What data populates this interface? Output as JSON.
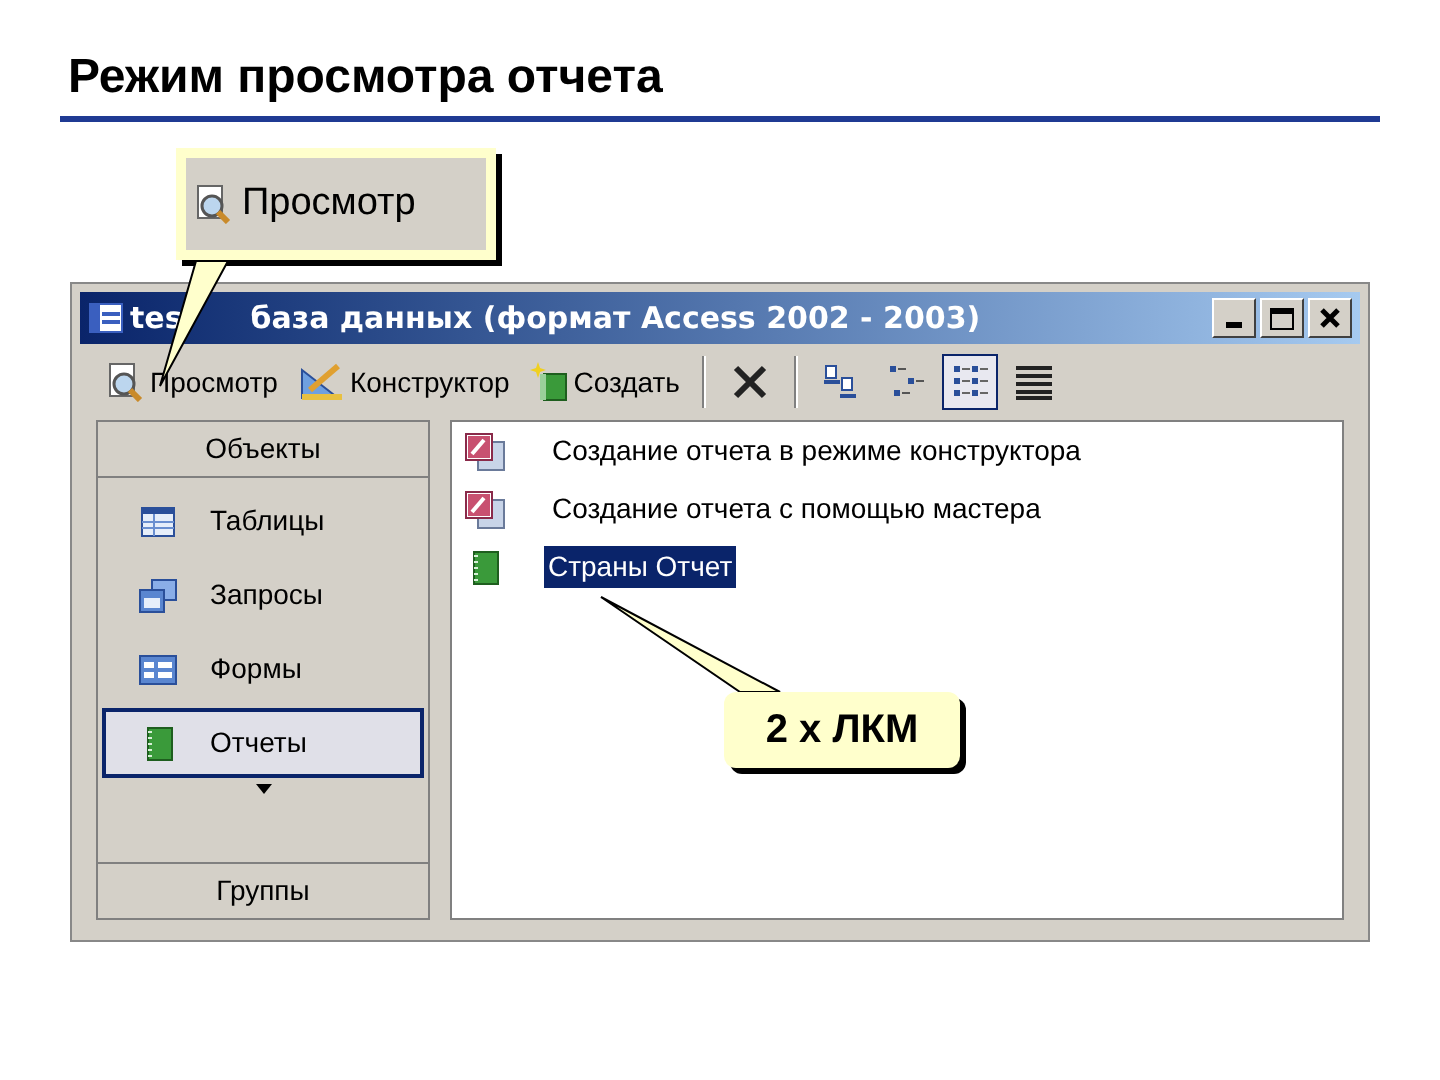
{
  "slide_title": "Режим просмотра отчета",
  "callout_top": {
    "label": "Просмотр"
  },
  "window": {
    "title_left": "tes",
    "title_right": "база данных (формат Access 2002 - 2003)"
  },
  "toolbar": [
    {
      "kind": "preview",
      "label": "Просмотр",
      "selected": false
    },
    {
      "kind": "design",
      "label": "Конструктор",
      "selected": false
    },
    {
      "kind": "new",
      "label": "Создать",
      "selected": false
    },
    {
      "kind": "sep"
    },
    {
      "kind": "delete",
      "selected": false
    },
    {
      "kind": "sep"
    },
    {
      "kind": "large",
      "selected": false
    },
    {
      "kind": "small",
      "selected": false
    },
    {
      "kind": "list",
      "selected": true
    },
    {
      "kind": "details",
      "selected": false
    }
  ],
  "sidebar": {
    "header": "Объекты",
    "items": [
      {
        "label": "Таблицы",
        "kind": "table",
        "selected": false
      },
      {
        "label": "Запросы",
        "kind": "query",
        "selected": false
      },
      {
        "label": "Формы",
        "kind": "form",
        "selected": false
      },
      {
        "label": "Отчеты",
        "kind": "report",
        "selected": true
      }
    ],
    "footer": "Группы"
  },
  "objects": [
    {
      "label": "Создание отчета в режиме конструктора",
      "kind": "wizard",
      "selected": false
    },
    {
      "label": "Создание отчета с помощью мастера",
      "kind": "wizard",
      "selected": false
    },
    {
      "label": "Страны Отчет",
      "kind": "report",
      "selected": true
    }
  ],
  "callout_bottom": {
    "label": "2 х ЛКМ"
  }
}
